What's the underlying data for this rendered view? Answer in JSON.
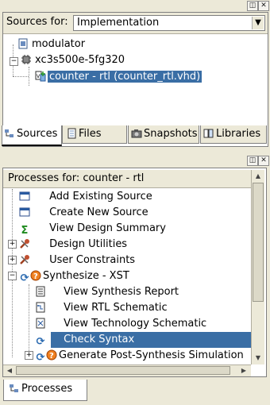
{
  "sources_panel": {
    "sources_for_label": "Sources for:",
    "sources_for_value": "Implementation",
    "tree": [
      {
        "label": "modulator",
        "icon": "module-icon",
        "selected": false
      },
      {
        "label": "xc3s500e-5fg320",
        "icon": "chip-icon",
        "selected": false
      },
      {
        "label": "counter - rtl (counter_rtl.vhd)",
        "icon": "vhdl-file-icon",
        "selected": true
      }
    ],
    "tabs": [
      {
        "label": "Sources",
        "icon": "sources-icon",
        "active": true
      },
      {
        "label": "Files",
        "icon": "files-icon",
        "active": false
      },
      {
        "label": "Snapshots",
        "icon": "snapshots-icon",
        "active": false
      },
      {
        "label": "Libraries",
        "icon": "libraries-icon",
        "active": false
      }
    ]
  },
  "processes_panel": {
    "header": "Processes for: counter - rtl",
    "items": [
      {
        "label": "Add Existing Source",
        "icon": "window-icon",
        "level": 1,
        "selected": false
      },
      {
        "label": "Create New Source",
        "icon": "window-icon",
        "level": 1,
        "selected": false
      },
      {
        "label": "View Design Summary",
        "icon": "sigma-icon",
        "level": 1,
        "selected": false
      },
      {
        "label": "Design Utilities",
        "icon": "tools-icon",
        "level": 1,
        "selected": false
      },
      {
        "label": "User Constraints",
        "icon": "tools-icon",
        "level": 1,
        "selected": false
      },
      {
        "label": "Synthesize - XST",
        "icon": "question-icon",
        "level": 1,
        "selected": false
      },
      {
        "label": "View Synthesis Report",
        "icon": "report-icon",
        "level": 2,
        "selected": false
      },
      {
        "label": "View RTL Schematic",
        "icon": "schematic-icon",
        "level": 2,
        "selected": false
      },
      {
        "label": "View Technology Schematic",
        "icon": "tech-schematic-icon",
        "level": 2,
        "selected": false
      },
      {
        "label": "Check Syntax",
        "icon": "refresh-icon",
        "level": 2,
        "selected": true
      },
      {
        "label": "Generate Post-Synthesis Simulation",
        "icon": "question-icon",
        "level": 2,
        "selected": false
      }
    ],
    "bottom_tab": "Processes"
  },
  "colors": {
    "selection": "#3a6ea5",
    "chrome": "#ece9d8"
  }
}
